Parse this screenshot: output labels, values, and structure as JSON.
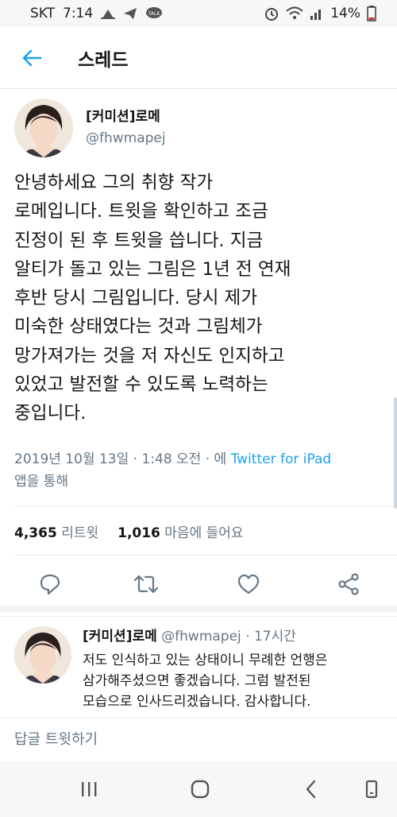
{
  "status_bar": {
    "carrier": "SKT",
    "time": "7:14",
    "talk_badge": "TALK",
    "battery": "14%"
  },
  "app_bar": {
    "title": "스레드",
    "back_icon": "arrow-left-icon"
  },
  "tweet": {
    "author_name": "[커미션]로메",
    "author_handle": "@fhwmapej",
    "text": "안녕하세요 그의 취향 작가\n로메입니다. 트윗을 확인하고 조금\n진정이 된 후 트윗을 씁니다. 지금\n알티가 돌고 있는 그림은 1년 전 연재\n후반 당시 그림입니다. 당시 제가\n미숙한 상태였다는 것과 그림체가\n망가져가는 것을 저 자신도 인지하고\n있었고 발전할 수 있도록 노력하는\n중입니다.",
    "timestamp": "2019년 10월 13일 · 1:48 오전 · 에",
    "source": "Twitter for iPad",
    "source_suffix": "앱을 통해",
    "retweet_count": "4,365",
    "retweet_label": "리트윗",
    "like_count": "1,016",
    "like_label": "마음에 들어요"
  },
  "actions": [
    "reply-icon",
    "retweet-icon",
    "like-icon",
    "share-icon"
  ],
  "reply": {
    "author_name": "[커미션]로메",
    "author_handle": "@fhwmapej",
    "time_ago": "· 17시간",
    "text": "저도 인식하고 있는 상태이니 무례한 언행은\n삼가해주셨으면 좋겠습니다. 그럼 발전된\n모습으로 인사드리겠습니다. 감사합니다."
  },
  "compose": {
    "placeholder": "답글 트윗하기"
  },
  "colors": {
    "accent": "#1da1f2",
    "text_primary": "#14171a",
    "text_secondary": "#657786",
    "divider": "#e6ecf0"
  }
}
